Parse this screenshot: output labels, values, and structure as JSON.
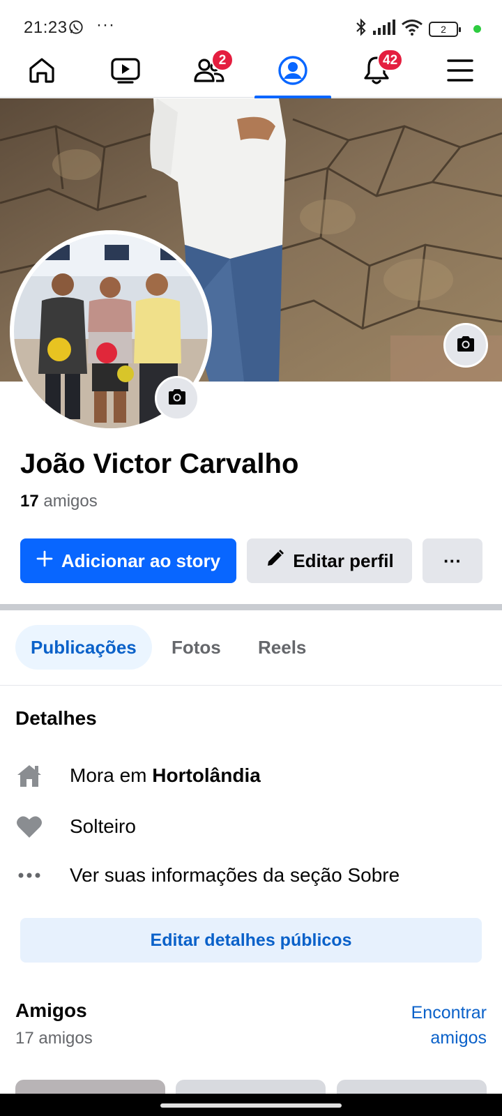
{
  "status_bar": {
    "time": "21:23",
    "overflow": "···",
    "battery": "2"
  },
  "nav": {
    "friends_badge": "2",
    "notifications_badge": "42"
  },
  "profile": {
    "name": "João Victor Carvalho",
    "friends_count": "17",
    "friends_label": "amigos"
  },
  "actions": {
    "add_story": "Adicionar ao story",
    "edit_profile": "Editar perfil",
    "more": "···"
  },
  "tabs": [
    {
      "label": "Publicações",
      "active": true
    },
    {
      "label": "Fotos",
      "active": false
    },
    {
      "label": "Reels",
      "active": false
    }
  ],
  "details": {
    "title": "Detalhes",
    "lives_prefix": "Mora em",
    "lives_city": "Hortolândia",
    "relationship": "Solteiro",
    "about": "Ver suas informações da seção Sobre",
    "edit_public": "Editar detalhes públicos"
  },
  "friends_section": {
    "title": "Amigos",
    "subtitle": "17 amigos",
    "find_line1": "Encontrar",
    "find_line2": "amigos"
  },
  "colors": {
    "accent": "#0866ff",
    "link": "#0a61c9",
    "badge": "#e41e3f"
  },
  "icons": [
    "whatsapp-icon",
    "bluetooth-icon",
    "signal-icon",
    "wifi-icon",
    "battery-icon",
    "home-icon",
    "video-icon",
    "friends-icon",
    "profile-icon",
    "bell-icon",
    "menu-icon",
    "camera-icon",
    "plus-icon",
    "pencil-icon",
    "house-icon",
    "heart-icon",
    "more-dots-icon"
  ]
}
